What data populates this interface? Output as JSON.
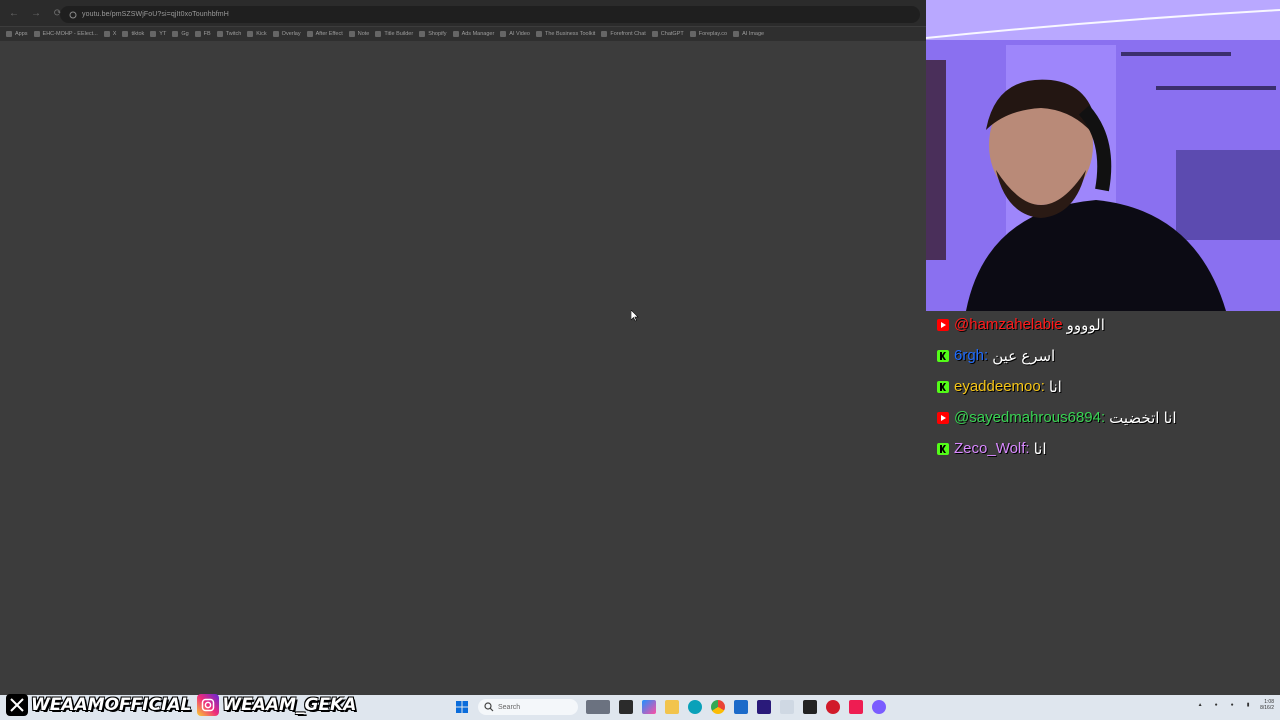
{
  "browser": {
    "url": "youtu.be/pmSZSWjFoU?si=qjIt0xoTounhbfmH",
    "bookmarks": [
      "Apps",
      "EHC-MOHP - EElect...",
      "X",
      "tiktok",
      "YT",
      "Gg",
      "FB",
      "Twitch",
      "Kick",
      "Overlay",
      "After Effect",
      "Note",
      "Title Builder",
      "Shopify",
      "Ads Manager",
      "AI Video",
      "The Business Toolkit",
      "Forefront Chat",
      "ChatGPT",
      "Foreplay.co",
      "AI Image"
    ]
  },
  "chat": {
    "messages": [
      {
        "platform": "youtube",
        "user": "@hamzahelabie",
        "text": "الوووو",
        "color": "#ff1a1a"
      },
      {
        "platform": "kick",
        "user": "6rgh:",
        "text": "اسرع عين",
        "color": "#1e6bff"
      },
      {
        "platform": "kick",
        "user": "eyaddeemoo:",
        "text": "انا",
        "color": "#f5c518"
      },
      {
        "platform": "youtube",
        "user": "@sayedmahrous6894:",
        "text": "انا اتخضيت",
        "color": "#39d353"
      },
      {
        "platform": "kick",
        "user": "Zeco_Wolf:",
        "text": "انا",
        "color": "#d889ff"
      }
    ]
  },
  "social": {
    "x_handle": "WEAAMOFFICIAL",
    "instagram_handle": "WEAAM_GEKA"
  },
  "taskbar": {
    "search_placeholder": "Search",
    "clock_time": "1:08",
    "clock_date": "8/16/2"
  }
}
